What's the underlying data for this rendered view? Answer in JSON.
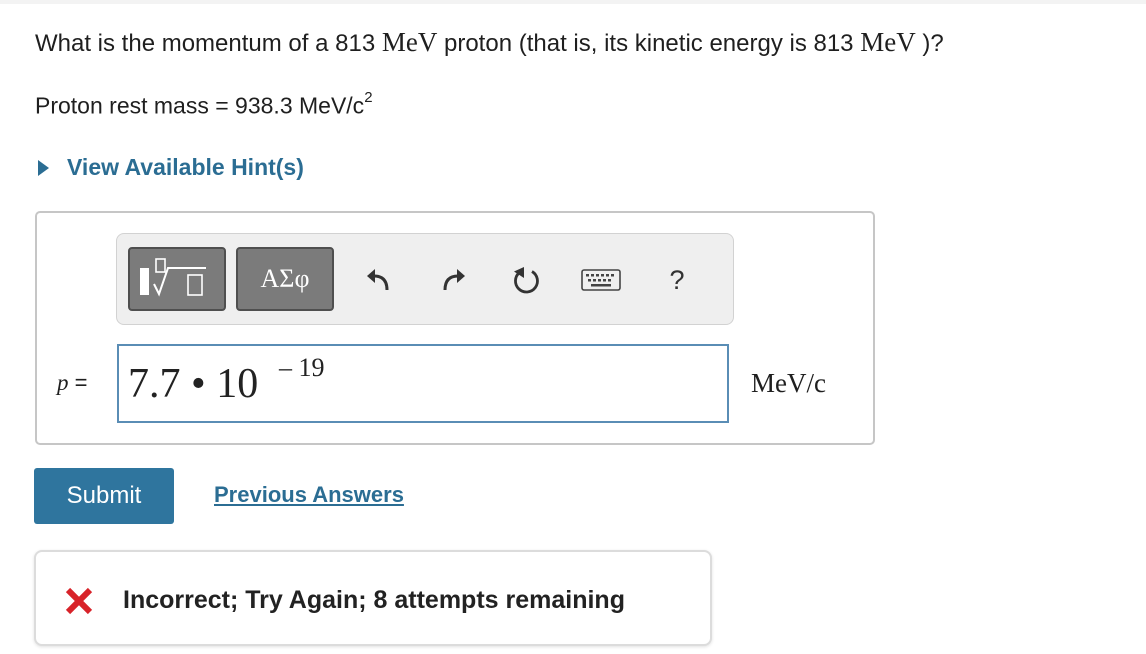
{
  "question": {
    "part1": "What is the momentum of a 813 ",
    "unit1": "MeV",
    "part2": " proton (that is, its kinetic energy is 813 ",
    "unit2": "MeV",
    "part3": " )?"
  },
  "given": {
    "text": "Proton rest mass = 938.3 MeV/c",
    "superscript": "2"
  },
  "hint": {
    "label": "View Available Hint(s)"
  },
  "toolbar": {
    "greek_label": "ΑΣφ",
    "help_label": "?",
    "icons": [
      "templates-icon",
      "greek-letters-icon",
      "undo-icon",
      "redo-icon",
      "reset-icon",
      "keyboard-icon",
      "help-icon"
    ]
  },
  "answer": {
    "variable": "p",
    "equals": " = ",
    "value": "7.7 • 10",
    "exponent": "– 19",
    "units": "MeV/c"
  },
  "actions": {
    "submit_label": "Submit",
    "previous_label": "Previous Answers"
  },
  "feedback": {
    "message": "Incorrect; Try Again; 8 attempts remaining",
    "status_color": "#d8232a"
  },
  "colors": {
    "accent": "#2f759e",
    "link": "#2b6d93",
    "error": "#d8232a"
  }
}
